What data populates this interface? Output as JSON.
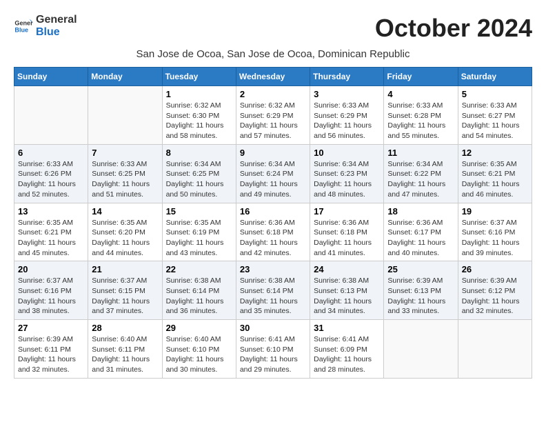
{
  "logo": {
    "line1": "General",
    "line2": "Blue"
  },
  "title": "October 2024",
  "location": "San Jose de Ocoa, San Jose de Ocoa, Dominican Republic",
  "weekdays": [
    "Sunday",
    "Monday",
    "Tuesday",
    "Wednesday",
    "Thursday",
    "Friday",
    "Saturday"
  ],
  "weeks": [
    [
      {
        "day": "",
        "info": ""
      },
      {
        "day": "",
        "info": ""
      },
      {
        "day": "1",
        "info": "Sunrise: 6:32 AM\nSunset: 6:30 PM\nDaylight: 11 hours and 58 minutes."
      },
      {
        "day": "2",
        "info": "Sunrise: 6:32 AM\nSunset: 6:29 PM\nDaylight: 11 hours and 57 minutes."
      },
      {
        "day": "3",
        "info": "Sunrise: 6:33 AM\nSunset: 6:29 PM\nDaylight: 11 hours and 56 minutes."
      },
      {
        "day": "4",
        "info": "Sunrise: 6:33 AM\nSunset: 6:28 PM\nDaylight: 11 hours and 55 minutes."
      },
      {
        "day": "5",
        "info": "Sunrise: 6:33 AM\nSunset: 6:27 PM\nDaylight: 11 hours and 54 minutes."
      }
    ],
    [
      {
        "day": "6",
        "info": "Sunrise: 6:33 AM\nSunset: 6:26 PM\nDaylight: 11 hours and 52 minutes."
      },
      {
        "day": "7",
        "info": "Sunrise: 6:33 AM\nSunset: 6:25 PM\nDaylight: 11 hours and 51 minutes."
      },
      {
        "day": "8",
        "info": "Sunrise: 6:34 AM\nSunset: 6:25 PM\nDaylight: 11 hours and 50 minutes."
      },
      {
        "day": "9",
        "info": "Sunrise: 6:34 AM\nSunset: 6:24 PM\nDaylight: 11 hours and 49 minutes."
      },
      {
        "day": "10",
        "info": "Sunrise: 6:34 AM\nSunset: 6:23 PM\nDaylight: 11 hours and 48 minutes."
      },
      {
        "day": "11",
        "info": "Sunrise: 6:34 AM\nSunset: 6:22 PM\nDaylight: 11 hours and 47 minutes."
      },
      {
        "day": "12",
        "info": "Sunrise: 6:35 AM\nSunset: 6:21 PM\nDaylight: 11 hours and 46 minutes."
      }
    ],
    [
      {
        "day": "13",
        "info": "Sunrise: 6:35 AM\nSunset: 6:21 PM\nDaylight: 11 hours and 45 minutes."
      },
      {
        "day": "14",
        "info": "Sunrise: 6:35 AM\nSunset: 6:20 PM\nDaylight: 11 hours and 44 minutes."
      },
      {
        "day": "15",
        "info": "Sunrise: 6:35 AM\nSunset: 6:19 PM\nDaylight: 11 hours and 43 minutes."
      },
      {
        "day": "16",
        "info": "Sunrise: 6:36 AM\nSunset: 6:18 PM\nDaylight: 11 hours and 42 minutes."
      },
      {
        "day": "17",
        "info": "Sunrise: 6:36 AM\nSunset: 6:18 PM\nDaylight: 11 hours and 41 minutes."
      },
      {
        "day": "18",
        "info": "Sunrise: 6:36 AM\nSunset: 6:17 PM\nDaylight: 11 hours and 40 minutes."
      },
      {
        "day": "19",
        "info": "Sunrise: 6:37 AM\nSunset: 6:16 PM\nDaylight: 11 hours and 39 minutes."
      }
    ],
    [
      {
        "day": "20",
        "info": "Sunrise: 6:37 AM\nSunset: 6:16 PM\nDaylight: 11 hours and 38 minutes."
      },
      {
        "day": "21",
        "info": "Sunrise: 6:37 AM\nSunset: 6:15 PM\nDaylight: 11 hours and 37 minutes."
      },
      {
        "day": "22",
        "info": "Sunrise: 6:38 AM\nSunset: 6:14 PM\nDaylight: 11 hours and 36 minutes."
      },
      {
        "day": "23",
        "info": "Sunrise: 6:38 AM\nSunset: 6:14 PM\nDaylight: 11 hours and 35 minutes."
      },
      {
        "day": "24",
        "info": "Sunrise: 6:38 AM\nSunset: 6:13 PM\nDaylight: 11 hours and 34 minutes."
      },
      {
        "day": "25",
        "info": "Sunrise: 6:39 AM\nSunset: 6:13 PM\nDaylight: 11 hours and 33 minutes."
      },
      {
        "day": "26",
        "info": "Sunrise: 6:39 AM\nSunset: 6:12 PM\nDaylight: 11 hours and 32 minutes."
      }
    ],
    [
      {
        "day": "27",
        "info": "Sunrise: 6:39 AM\nSunset: 6:11 PM\nDaylight: 11 hours and 32 minutes."
      },
      {
        "day": "28",
        "info": "Sunrise: 6:40 AM\nSunset: 6:11 PM\nDaylight: 11 hours and 31 minutes."
      },
      {
        "day": "29",
        "info": "Sunrise: 6:40 AM\nSunset: 6:10 PM\nDaylight: 11 hours and 30 minutes."
      },
      {
        "day": "30",
        "info": "Sunrise: 6:41 AM\nSunset: 6:10 PM\nDaylight: 11 hours and 29 minutes."
      },
      {
        "day": "31",
        "info": "Sunrise: 6:41 AM\nSunset: 6:09 PM\nDaylight: 11 hours and 28 minutes."
      },
      {
        "day": "",
        "info": ""
      },
      {
        "day": "",
        "info": ""
      }
    ]
  ]
}
